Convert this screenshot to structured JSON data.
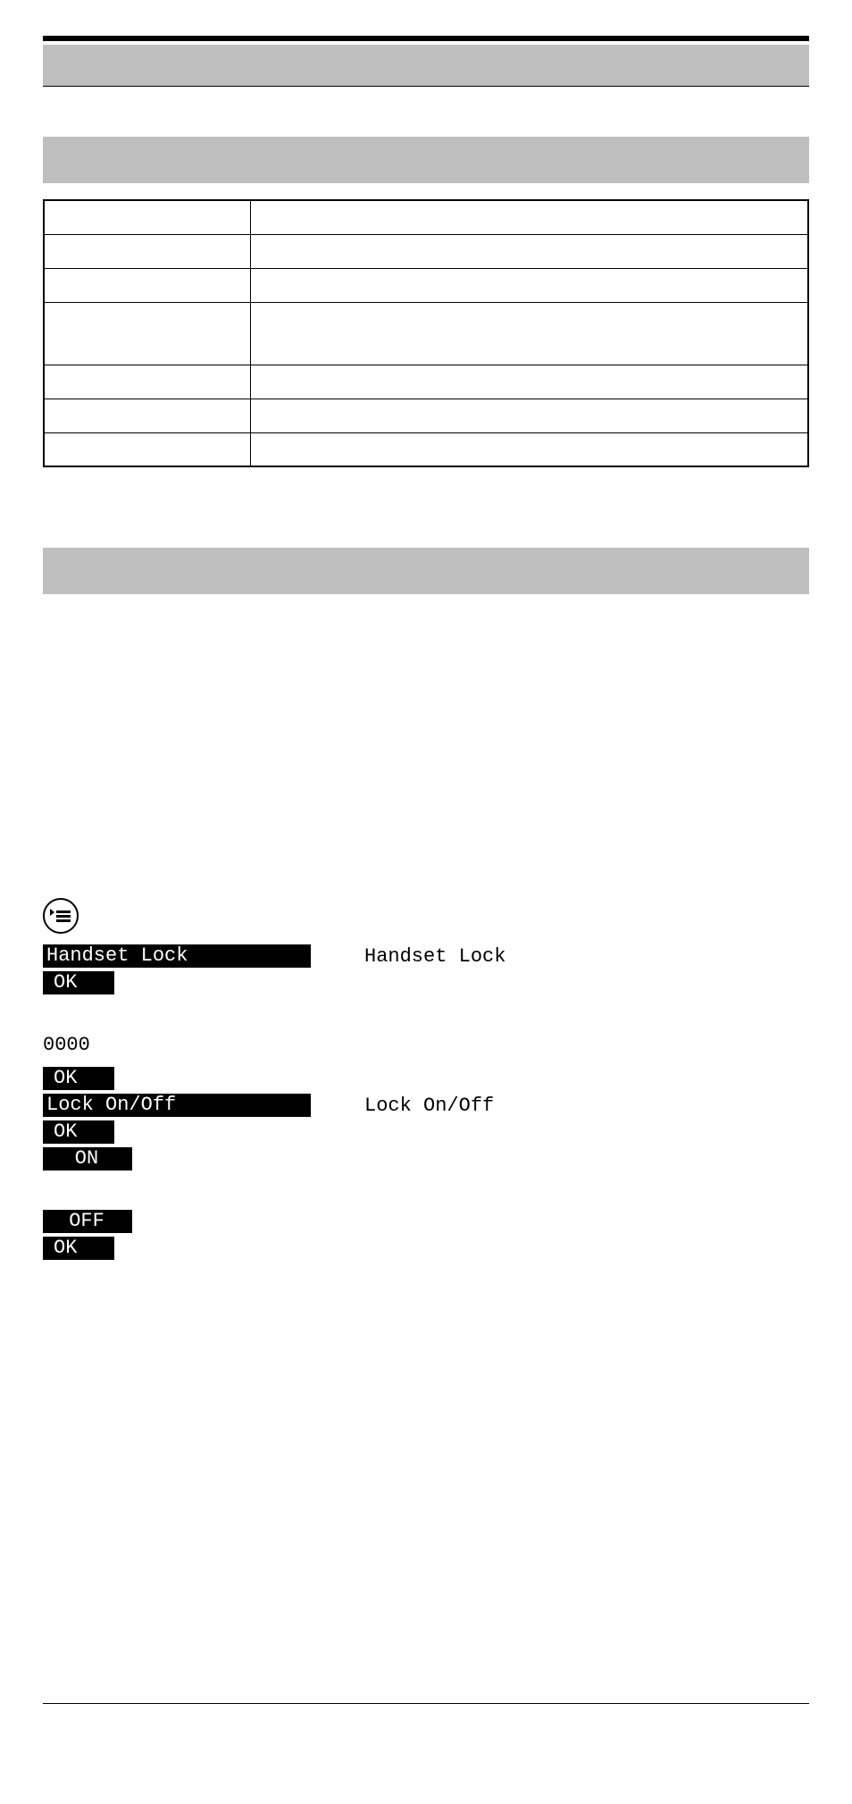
{
  "header": {},
  "table": {
    "rows": [
      {
        "left": "",
        "right": ""
      },
      {
        "left": "",
        "right": ""
      },
      {
        "left": "",
        "right": ""
      },
      {
        "left": "",
        "right": "",
        "tall": true
      },
      {
        "left": "",
        "right": ""
      },
      {
        "left": "",
        "right": ""
      },
      {
        "left": "",
        "right": ""
      }
    ]
  },
  "steps": {
    "handset_lock_inv": "Handset Lock",
    "handset_lock_plain": "Handset Lock",
    "ok": "OK",
    "pin_default": "0000",
    "lock_onoff_inv": "Lock On/Off",
    "lock_onoff_plain": "Lock On/Off",
    "on": "ON",
    "off": "OFF"
  }
}
